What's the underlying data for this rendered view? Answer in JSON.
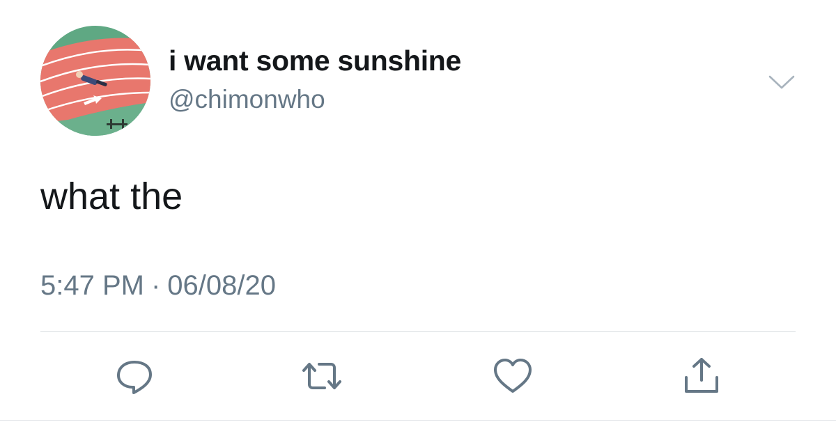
{
  "user": {
    "display_name": "i want some sunshine",
    "handle": "@chimonwho",
    "avatar_icon": "avatar-running-track-photo"
  },
  "tweet": {
    "text": "what the",
    "time": "5:47 PM",
    "separator": "·",
    "date": "06/08/20"
  },
  "actions": [
    {
      "icon": "reply-icon"
    },
    {
      "icon": "retweet-icon"
    },
    {
      "icon": "like-icon"
    },
    {
      "icon": "share-icon"
    }
  ],
  "menu": {
    "icon": "chevron-down-icon"
  },
  "colors": {
    "text_primary": "#14171a",
    "text_secondary": "#657786",
    "icon": "#657786",
    "divider": "#d6dbdf"
  }
}
